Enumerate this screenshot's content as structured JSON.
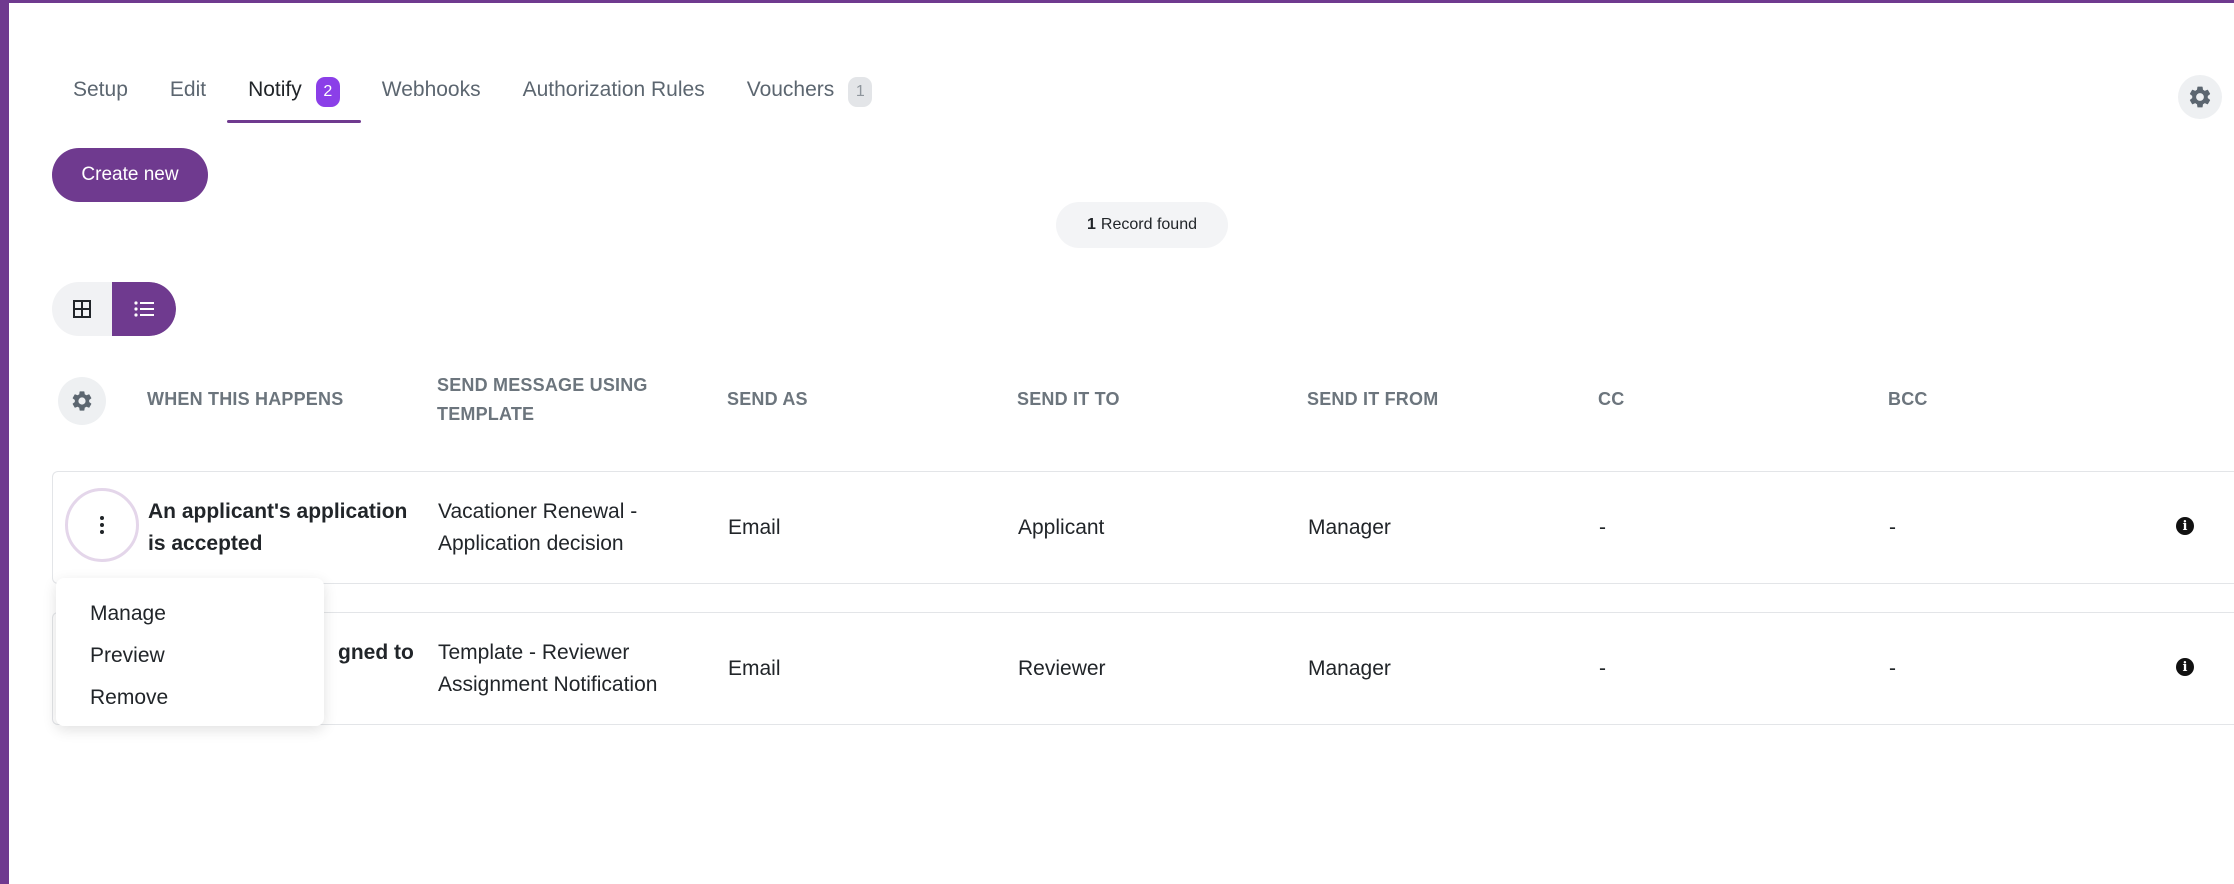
{
  "tabs": [
    {
      "label": "Setup"
    },
    {
      "label": "Edit"
    },
    {
      "label": "Notify",
      "badge": "2"
    },
    {
      "label": "Webhooks"
    },
    {
      "label": "Authorization Rules"
    },
    {
      "label": "Vouchers",
      "badge": "1"
    }
  ],
  "actions": {
    "create_new": "Create new"
  },
  "records": {
    "count": "1",
    "label": "Record found"
  },
  "table": {
    "columns": [
      "WHEN THIS HAPPENS",
      "SEND MESSAGE USING TEMPLATE",
      "SEND AS",
      "SEND IT TO",
      "SEND IT FROM",
      "CC",
      "BCC"
    ],
    "rows": [
      {
        "event_line1": "An applicant's application",
        "event_line2": "is accepted",
        "template_line1": "Vacationer Renewal -",
        "template_line2": "Application decision",
        "send_as": "Email",
        "send_to": "Applicant",
        "send_from": "Manager",
        "cc": "-",
        "bcc": "-"
      },
      {
        "event_line1": "gned to",
        "template_line1": "Template - Reviewer",
        "template_line2": "Assignment Notification",
        "send_as": "Email",
        "send_to": "Reviewer",
        "send_from": "Manager",
        "cc": "-",
        "bcc": "-"
      }
    ]
  },
  "context_menu": {
    "items": [
      "Manage",
      "Preview",
      "Remove"
    ]
  },
  "colors": {
    "brand": "#6f3a8f",
    "badge_active": "#8b3fe8"
  }
}
